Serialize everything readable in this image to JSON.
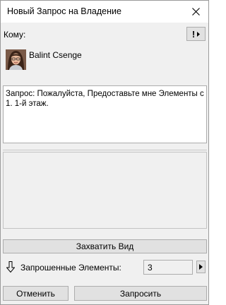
{
  "window": {
    "title": "Новый Запрос на Владение",
    "close_icon": "close-icon"
  },
  "recipient": {
    "label": "Кому:",
    "priority_mark": "!",
    "priority_icon": "dropdown-arrow-icon",
    "user_name": "Balint Csenge",
    "avatar_icon": "user-avatar"
  },
  "message": {
    "text": "Запрос: Пожалуйста, Предоставьте мне Элементы с 1. 1-й этаж."
  },
  "capture": {
    "button_label": "Захватить Вид"
  },
  "requested": {
    "icon": "down-arrow-icon",
    "label": "Запрошенные Элементы:",
    "count": "3",
    "arrow_icon": "right-arrow-icon"
  },
  "footer": {
    "cancel_label": "Отменить",
    "submit_label": "Запросить"
  }
}
